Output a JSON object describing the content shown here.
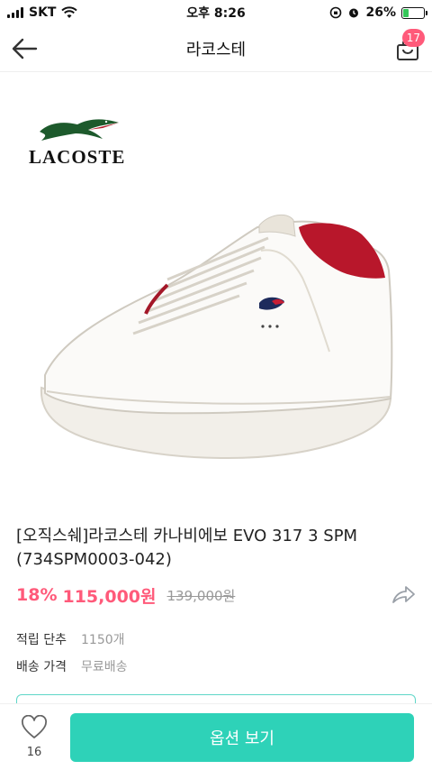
{
  "status_bar": {
    "carrier": "SKT",
    "time": "오후 8:26",
    "battery": "26%",
    "battery_level": 0.26
  },
  "header": {
    "back_icon": "arrow-left-icon",
    "title": "라코스테",
    "cart_icon": "shopping-bag-icon",
    "cart_count": "17"
  },
  "product": {
    "brand_logo_text": "LACOSTE",
    "name": "[오직스쉐]라코스테 카나비에보 EVO 317 3 SPM (734SPM0003-042)",
    "discount": "18%",
    "price": "115,000원",
    "original_price": "139,000원",
    "share_icon": "share-icon",
    "points_label": "적립 단추",
    "points_value": "1150개",
    "shipping_label": "배송 가격",
    "shipping_value": "무료배송"
  },
  "bottom_bar": {
    "like_icon": "heart-icon",
    "like_count": "16",
    "option_button": "옵션 보기"
  },
  "colors": {
    "accent": "#2ed2b8",
    "price": "#ff5a7a",
    "badge": "#ff5a7a"
  }
}
